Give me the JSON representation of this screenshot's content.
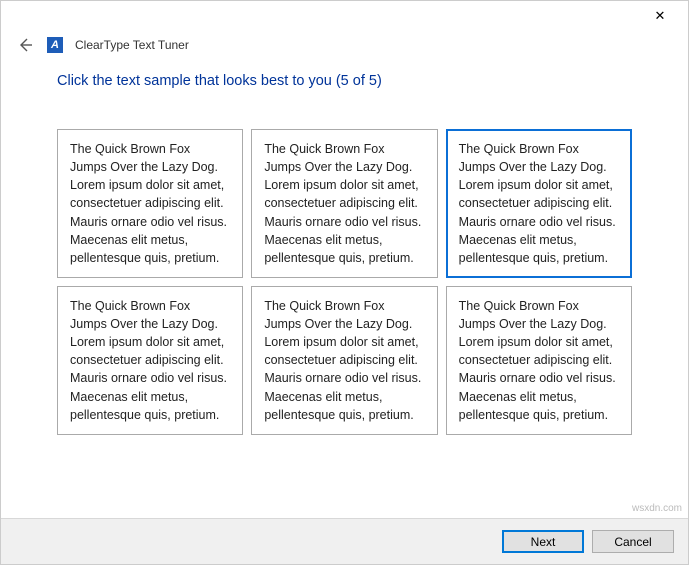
{
  "window": {
    "close_glyph": "✕",
    "app_title": "ClearType Text Tuner",
    "app_icon_letter": "A"
  },
  "heading": "Click the text sample that looks best to you (5 of 5)",
  "sample_text": "The Quick Brown Fox Jumps Over the Lazy Dog. Lorem ipsum dolor sit amet, consectetuer adipiscing elit. Mauris ornare odio vel risus. Maecenas elit metus, pellentesque quis, pretium.",
  "samples": [
    {
      "selected": false
    },
    {
      "selected": false
    },
    {
      "selected": true
    },
    {
      "selected": false
    },
    {
      "selected": false
    },
    {
      "selected": false
    }
  ],
  "footer": {
    "next_label": "Next",
    "cancel_label": "Cancel"
  },
  "watermark": "wsxdn.com"
}
